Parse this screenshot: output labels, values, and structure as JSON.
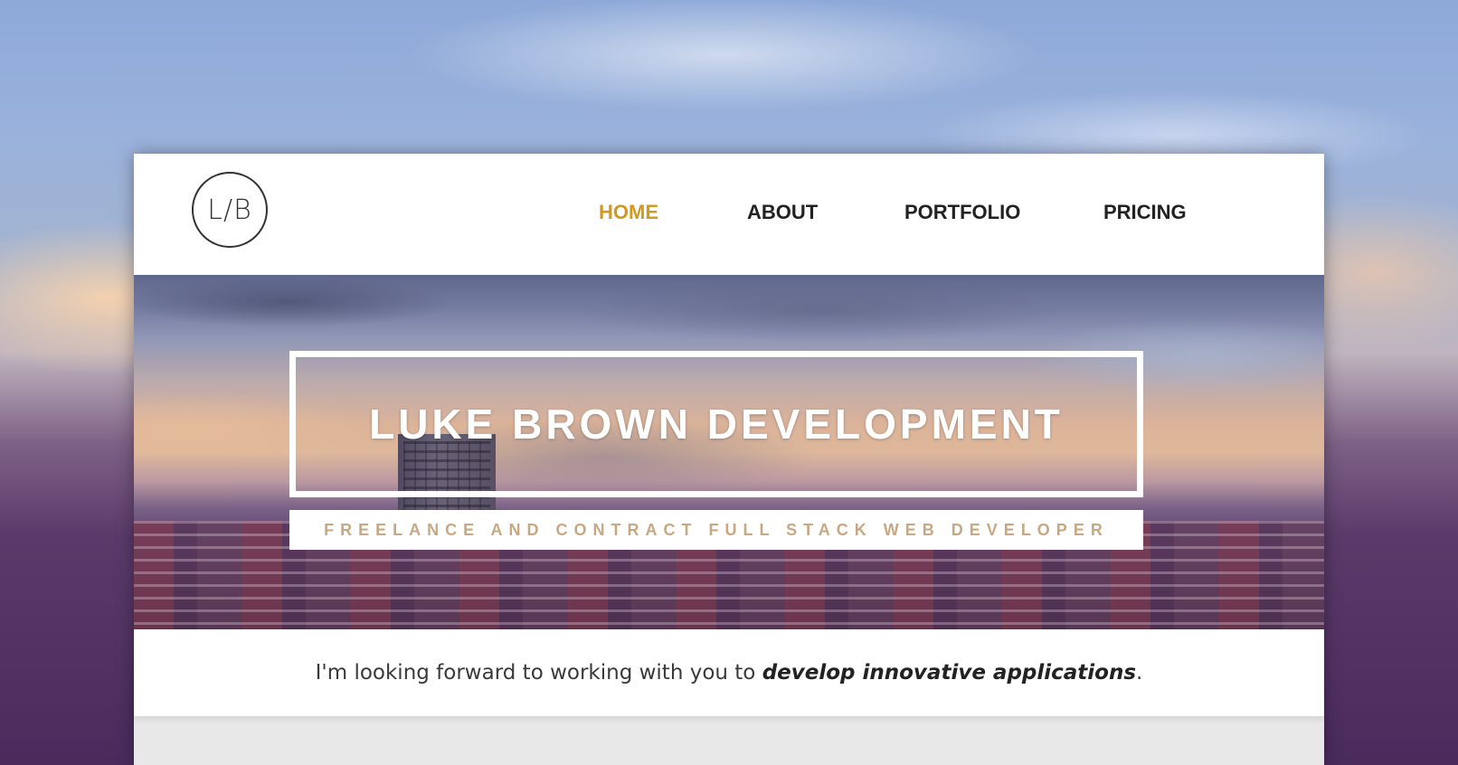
{
  "logo": {
    "text": "L/B"
  },
  "nav": {
    "items": [
      {
        "label": "HOME",
        "active": true
      },
      {
        "label": "ABOUT",
        "active": false
      },
      {
        "label": "PORTFOLIO",
        "active": false
      },
      {
        "label": "PRICING",
        "active": false
      }
    ]
  },
  "hero": {
    "title": "LUKE BROWN DEVELOPMENT",
    "subtitle": "FREELANCE AND CONTRACT FULL STACK WEB DEVELOPER"
  },
  "intro": {
    "lead": "I'm looking forward to working with you to ",
    "emphasis": "develop innovative applications",
    "tail": "."
  },
  "colors": {
    "accent": "#d19a1f",
    "subtitle": "#c7a882",
    "nav_text": "#222222"
  }
}
